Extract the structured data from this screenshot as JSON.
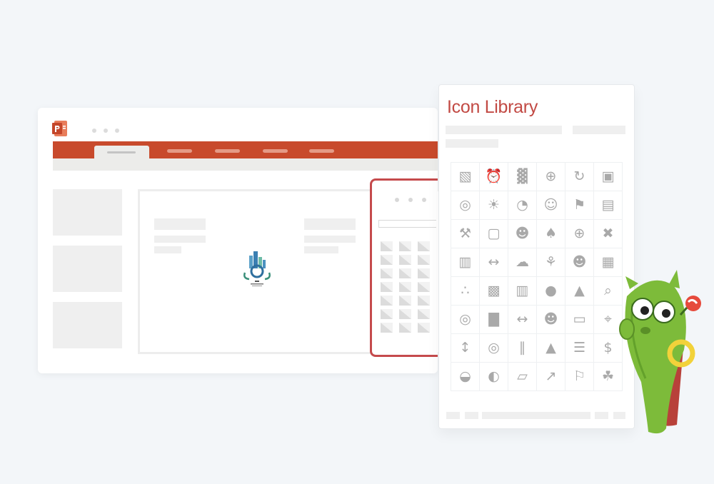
{
  "icon_library": {
    "title": "Icon Library",
    "icons": [
      "presentation-chart-icon",
      "alarm-clock-icon",
      "growth-bars-icon",
      "dollar-globe-icon",
      "refresh-dollar-icon",
      "video-camera-icon",
      "target-arrow-icon",
      "lightbulb-icon",
      "pie-chart-icon",
      "headset-support-icon",
      "flag-icon",
      "comment-user-icon",
      "tools-icon",
      "presenter-icon",
      "engineer-icon",
      "trophy-icon",
      "globe-icon",
      "wrench-screwdriver-icon",
      "train-icon",
      "handshake-icon",
      "network-cloud-icon",
      "hand-plant-icon",
      "user-settings-icon",
      "wallet-icon",
      "scatter-chart-icon",
      "shopping-cart-icon",
      "office-building-icon",
      "chat-bubbles-icon",
      "rocket-icon",
      "magnifier-icon",
      "radar-icon",
      "bar-chart-icon",
      "handshake-deal-icon",
      "team-chat-icon",
      "money-icon",
      "crosshair-target-icon",
      "signpost-icon",
      "focus-target-icon",
      "teamwork-icon",
      "rocket-launch-icon",
      "abacus-icon",
      "dollar-coin-icon",
      "planet-icon",
      "toggle-switch-icon",
      "boat-icon",
      "line-growth-chart-icon",
      "goal-flag-icon",
      "money-bag-hands-icon"
    ],
    "glyphs": [
      "▧",
      "⏰",
      "▓",
      "⊕",
      "↻",
      "▣",
      "◎",
      "☀",
      "◔",
      "☺",
      "⚑",
      "▤",
      "⚒",
      "▢",
      "☻",
      "♠",
      "⊕",
      "✖",
      "▥",
      "↔",
      "☁",
      "⚘",
      "☻",
      "▦",
      "∴",
      "▩",
      "▥",
      "●",
      "▲",
      "⌕",
      "◎",
      "▇",
      "↔",
      "☻",
      "▭",
      "⌖",
      "↕",
      "◎",
      "∥",
      "▲",
      "☰",
      "$",
      "◒",
      "◐",
      "▱",
      "↗",
      "⚐",
      "☘"
    ]
  },
  "colors": {
    "accent": "#c24a44",
    "ribbon": "#c84a2c",
    "icon": "#a9a9a9"
  }
}
